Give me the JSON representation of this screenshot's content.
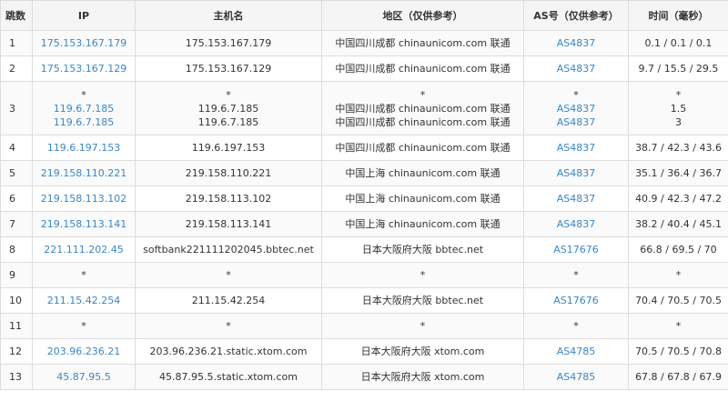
{
  "headers": {
    "hop": "跳数",
    "ip": "IP",
    "host": "主机名",
    "area": "地区（仅供参考）",
    "as": "AS号（仅供参考）",
    "time": "时间（毫秒）"
  },
  "colors": {
    "link": "#3a86c8",
    "border": "#dddddd",
    "header_bg": "#f5f5f5"
  },
  "rows": [
    {
      "hop": "1",
      "ip": [
        "175.153.167.179"
      ],
      "host": [
        "175.153.167.179"
      ],
      "area": [
        "中国四川成都 chinaunicom.com 联通"
      ],
      "as": [
        "AS4837"
      ],
      "time": [
        "0.1 / 0.1 / 0.1"
      ]
    },
    {
      "hop": "2",
      "ip": [
        "175.153.167.129"
      ],
      "host": [
        "175.153.167.129"
      ],
      "area": [
        "中国四川成都 chinaunicom.com 联通"
      ],
      "as": [
        "AS4837"
      ],
      "time": [
        "9.7 / 15.5 / 29.5"
      ]
    },
    {
      "hop": "3",
      "ip": [
        "*",
        "119.6.7.185",
        "119.6.7.185"
      ],
      "host": [
        "*",
        "119.6.7.185",
        "119.6.7.185"
      ],
      "area": [
        "*",
        "中国四川成都 chinaunicom.com 联通",
        "中国四川成都 chinaunicom.com 联通"
      ],
      "as": [
        "*",
        "AS4837",
        "AS4837"
      ],
      "time": [
        "*",
        "1.5",
        "3"
      ]
    },
    {
      "hop": "4",
      "ip": [
        "119.6.197.153"
      ],
      "host": [
        "119.6.197.153"
      ],
      "area": [
        "中国四川成都 chinaunicom.com 联通"
      ],
      "as": [
        "AS4837"
      ],
      "time": [
        "38.7 / 42.3 / 43.6"
      ]
    },
    {
      "hop": "5",
      "ip": [
        "219.158.110.221"
      ],
      "host": [
        "219.158.110.221"
      ],
      "area": [
        "中国上海 chinaunicom.com 联通"
      ],
      "as": [
        "AS4837"
      ],
      "time": [
        "35.1 / 36.4 / 36.7"
      ]
    },
    {
      "hop": "6",
      "ip": [
        "219.158.113.102"
      ],
      "host": [
        "219.158.113.102"
      ],
      "area": [
        "中国上海 chinaunicom.com 联通"
      ],
      "as": [
        "AS4837"
      ],
      "time": [
        "40.9 / 42.3 / 47.2"
      ]
    },
    {
      "hop": "7",
      "ip": [
        "219.158.113.141"
      ],
      "host": [
        "219.158.113.141"
      ],
      "area": [
        "中国上海 chinaunicom.com 联通"
      ],
      "as": [
        "AS4837"
      ],
      "time": [
        "38.2 / 40.4 / 45.1"
      ]
    },
    {
      "hop": "8",
      "ip": [
        "221.111.202.45"
      ],
      "host": [
        "softbank221111202045.bbtec.net"
      ],
      "area": [
        "日本大阪府大阪 bbtec.net"
      ],
      "as": [
        "AS17676"
      ],
      "time": [
        "66.8 / 69.5 / 70"
      ]
    },
    {
      "hop": "9",
      "ip": [
        "*"
      ],
      "host": [
        "*"
      ],
      "area": [
        "*"
      ],
      "as": [
        "*"
      ],
      "time": [
        "*"
      ]
    },
    {
      "hop": "10",
      "ip": [
        "211.15.42.254"
      ],
      "host": [
        "211.15.42.254"
      ],
      "area": [
        "日本大阪府大阪 bbtec.net"
      ],
      "as": [
        "AS17676"
      ],
      "time": [
        "70.4 / 70.5 / 70.5"
      ]
    },
    {
      "hop": "11",
      "ip": [
        "*"
      ],
      "host": [
        "*"
      ],
      "area": [
        "*"
      ],
      "as": [
        "*"
      ],
      "time": [
        "*"
      ]
    },
    {
      "hop": "12",
      "ip": [
        "203.96.236.21"
      ],
      "host": [
        "203.96.236.21.static.xtom.com"
      ],
      "area": [
        "日本大阪府大阪 xtom.com"
      ],
      "as": [
        "AS4785"
      ],
      "time": [
        "70.5 / 70.5 / 70.8"
      ]
    },
    {
      "hop": "13",
      "ip": [
        "45.87.95.5"
      ],
      "host": [
        "45.87.95.5.static.xtom.com"
      ],
      "area": [
        "日本大阪府大阪 xtom.com"
      ],
      "as": [
        "AS4785"
      ],
      "time": [
        "67.8 / 67.8 / 67.9"
      ]
    }
  ]
}
